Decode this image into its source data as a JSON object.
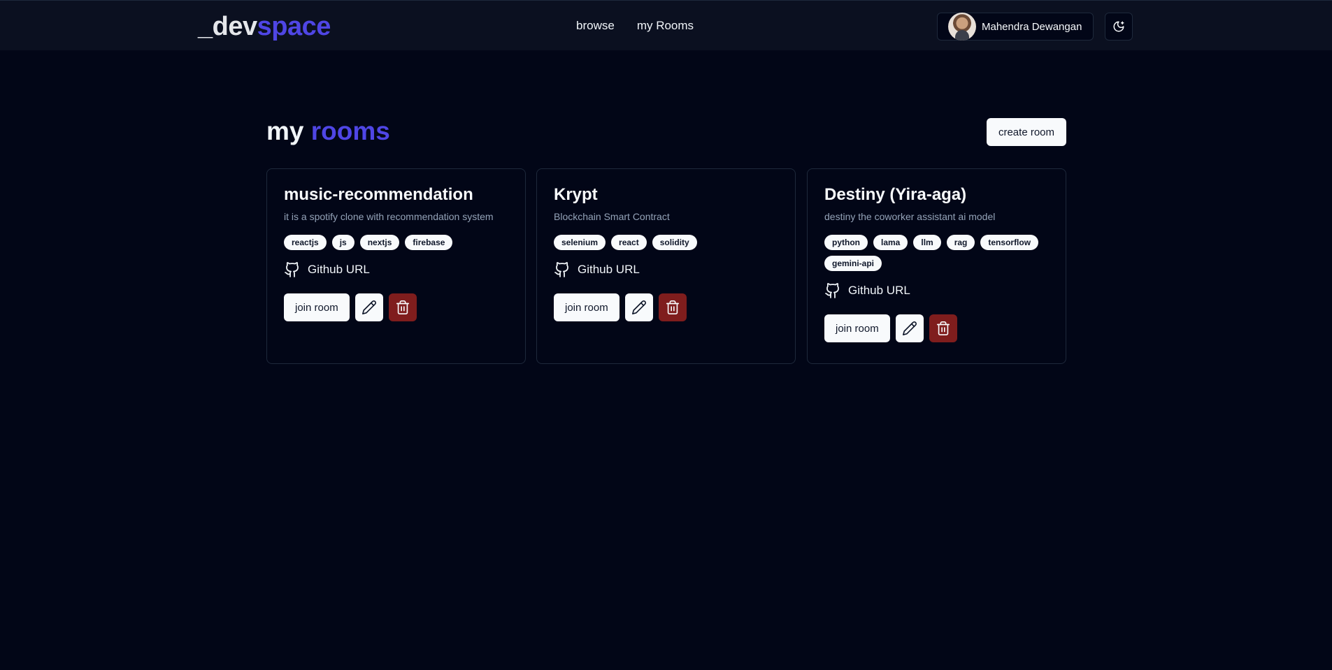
{
  "header": {
    "logo_prefix": "_dev",
    "logo_suffix": "space",
    "nav": [
      "browse",
      "my Rooms"
    ],
    "user_name": "Mahendra Dewangan",
    "theme_icon": "moon-icon"
  },
  "page": {
    "title_word1": "my",
    "title_word2": "rooms",
    "create_label": "create room"
  },
  "colors": {
    "background": "#020617",
    "accent": "#4f46e5",
    "danger": "#7f1d1d"
  },
  "rooms": [
    {
      "name": "music-recommendation",
      "description": "it is a spotify clone with recommendation system",
      "tags": [
        "reactjs",
        "js",
        "nextjs",
        "firebase"
      ],
      "github_label": "Github URL",
      "join_label": "join room"
    },
    {
      "name": "Krypt",
      "description": "Blockchain Smart Contract",
      "tags": [
        "selenium",
        "react",
        "solidity"
      ],
      "github_label": "Github URL",
      "join_label": "join room"
    },
    {
      "name": "Destiny (Yira-aga)",
      "description": "destiny the coworker assistant ai model",
      "tags": [
        "python",
        "lama",
        "llm",
        "rag",
        "tensorflow",
        "gemini-api"
      ],
      "github_label": "Github URL",
      "join_label": "join room"
    }
  ]
}
